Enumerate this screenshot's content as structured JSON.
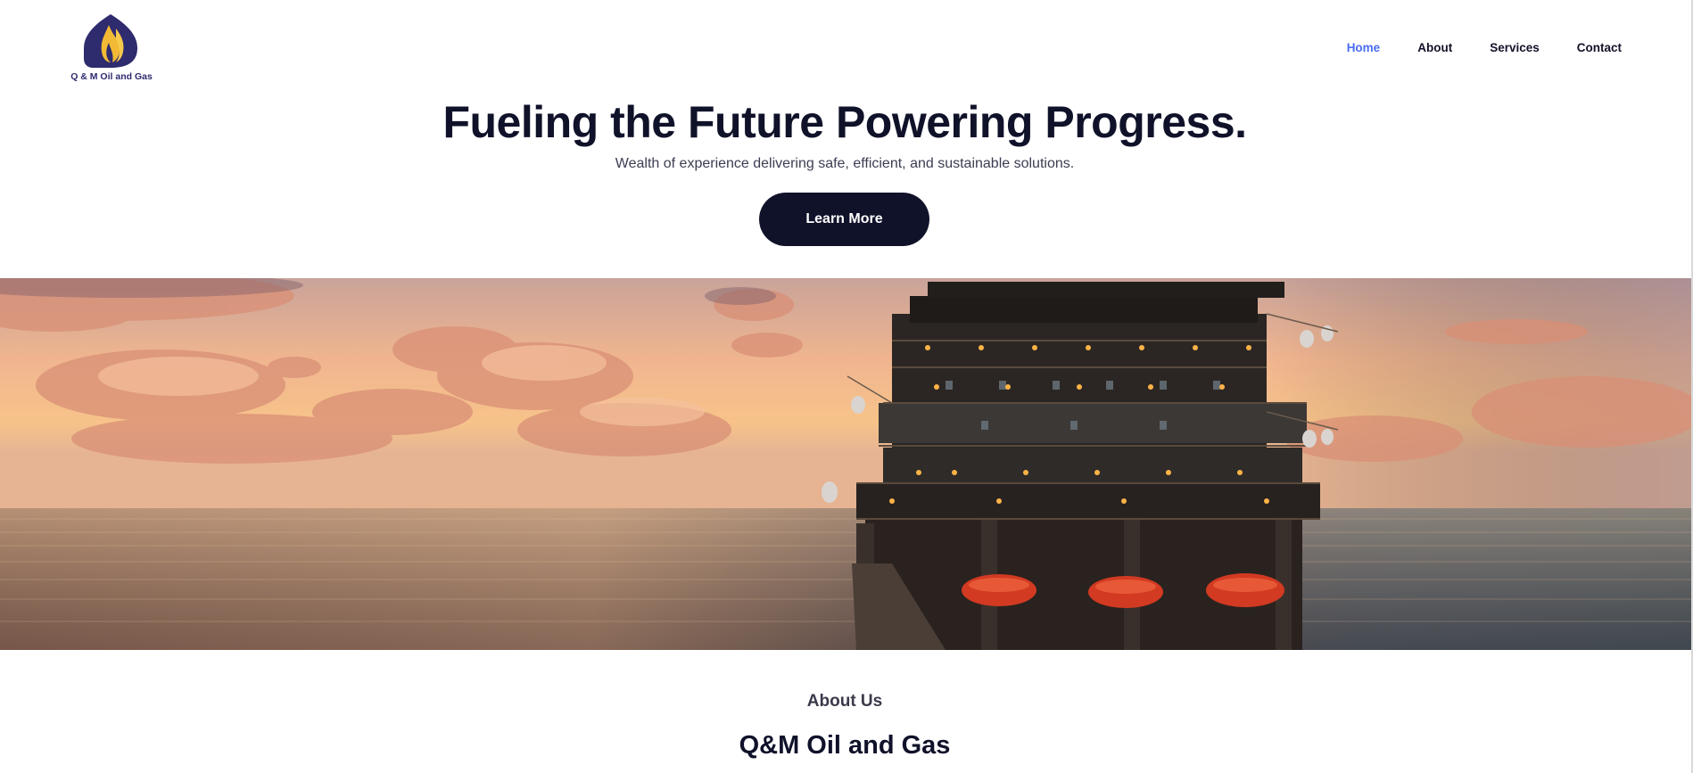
{
  "brand": {
    "name": "Q & M Oil and Gas",
    "logo_icon": "flame-drop-icon",
    "logo_colors": {
      "drop": "#2e2b6e",
      "flame": "#f2b935"
    }
  },
  "nav": {
    "items": [
      {
        "label": "Home",
        "active": true
      },
      {
        "label": "About",
        "active": false
      },
      {
        "label": "Services",
        "active": false
      },
      {
        "label": "Contact",
        "active": false
      }
    ]
  },
  "hero": {
    "title": "Fueling the Future Powering Progress.",
    "subtitle": "Wealth of experience delivering safe, efficient, and sustainable solutions.",
    "cta_label": "Learn More"
  },
  "banner": {
    "description_icon": "offshore-rig-image"
  },
  "about": {
    "label": "About Us",
    "title": "Q&M Oil and Gas"
  },
  "colors": {
    "accent": "#4a6cf0",
    "dark": "#10122a"
  }
}
